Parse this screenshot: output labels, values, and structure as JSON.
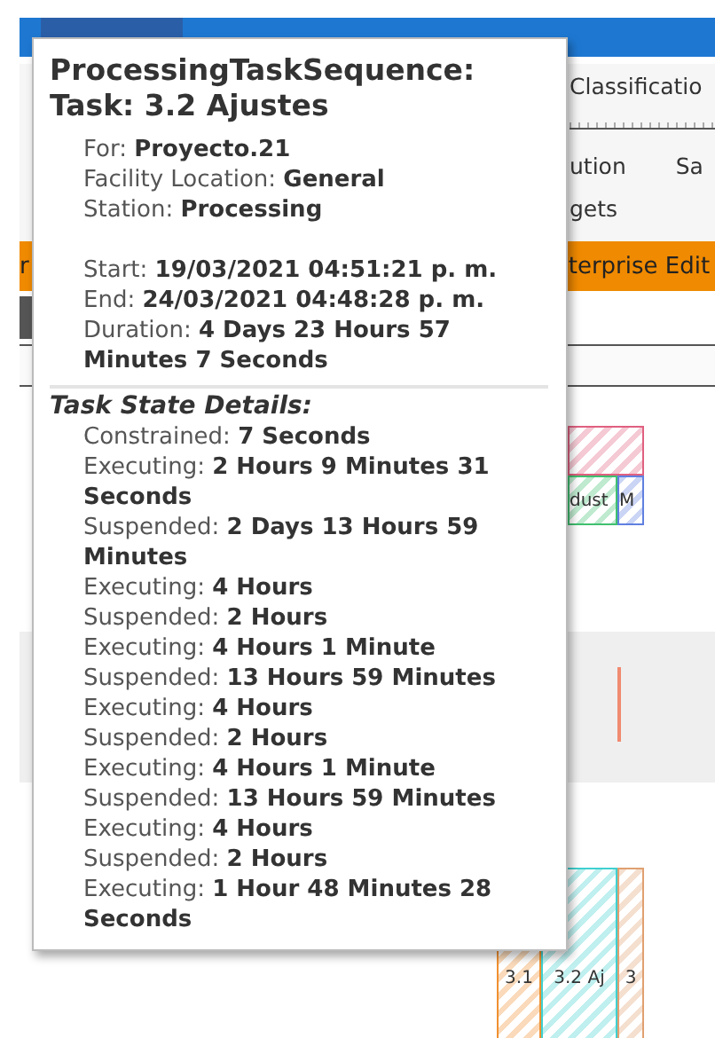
{
  "ribbon": {
    "group_1": "Classificatio",
    "group_2": "ution",
    "group_3": "Sa",
    "group_4": "gets"
  },
  "edition_bar": {
    "left": "r",
    "right": "terprise Edit"
  },
  "gantt": {
    "bars_top": [
      {
        "color": "#e06080"
      },
      {
        "label": "dust",
        "color": "#40c070"
      },
      {
        "label": "M",
        "color": "#6080e0"
      }
    ],
    "bars_bottom": [
      {
        "label": "3.1",
        "color": "#f09030"
      },
      {
        "label": "3.2 Aj",
        "color": "#40d0d0"
      },
      {
        "label": "3",
        "color": "#e0a070"
      }
    ]
  },
  "tooltip": {
    "title": "ProcessingTaskSequence: Task: 3.2 Ajustes",
    "info": [
      {
        "label": "For:",
        "value": "Proyecto.21"
      },
      {
        "label": "Facility Location:",
        "value": "General"
      },
      {
        "label": "Station:",
        "value": "Processing"
      }
    ],
    "times": [
      {
        "label": "Start:",
        "value": "19/03/2021 04:51:21 p. m."
      },
      {
        "label": "End:",
        "value": "24/03/2021 04:48:28 p. m."
      },
      {
        "label": "Duration:",
        "value": "4 Days 23 Hours 57 Minutes 7 Seconds"
      }
    ],
    "section_title": "Task State Details:",
    "states": [
      {
        "label": "Constrained:",
        "value": "7 Seconds"
      },
      {
        "label": "Executing:",
        "value": "2 Hours 9 Minutes 31 Seconds"
      },
      {
        "label": "Suspended:",
        "value": "2 Days 13 Hours 59 Minutes"
      },
      {
        "label": "Executing:",
        "value": "4 Hours"
      },
      {
        "label": "Suspended:",
        "value": "2 Hours"
      },
      {
        "label": "Executing:",
        "value": "4 Hours 1 Minute"
      },
      {
        "label": "Suspended:",
        "value": "13 Hours 59 Minutes"
      },
      {
        "label": "Executing:",
        "value": "4 Hours"
      },
      {
        "label": "Suspended:",
        "value": "2 Hours"
      },
      {
        "label": "Executing:",
        "value": "4 Hours 1 Minute"
      },
      {
        "label": "Suspended:",
        "value": "13 Hours 59 Minutes"
      },
      {
        "label": "Executing:",
        "value": "4 Hours"
      },
      {
        "label": "Suspended:",
        "value": "2 Hours"
      },
      {
        "label": "Executing:",
        "value": "1 Hour 48 Minutes 28 Seconds"
      }
    ]
  }
}
